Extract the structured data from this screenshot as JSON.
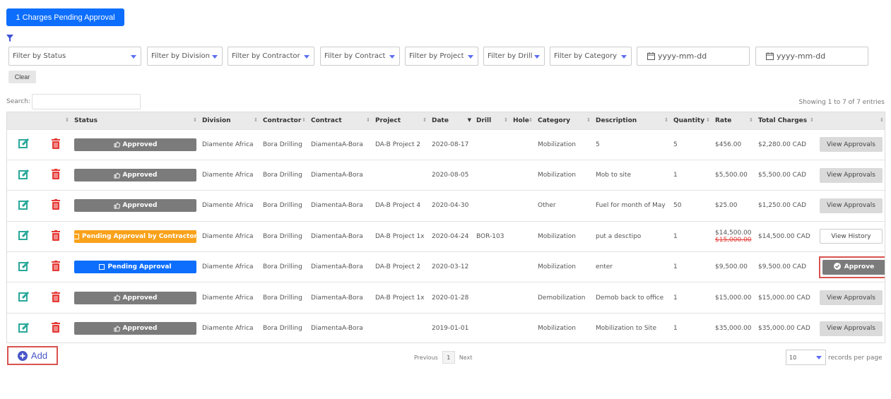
{
  "header": {
    "pending_label": "1 Charges Pending Approval"
  },
  "filters": [
    {
      "label": "Filter by Status"
    },
    {
      "label": "Filter by Division"
    },
    {
      "label": "Filter by Contractor"
    },
    {
      "label": "Filter by Contract"
    },
    {
      "label": "Filter by Project"
    },
    {
      "label": "Filter by Drill"
    },
    {
      "label": "Filter by Category"
    }
  ],
  "dates": [
    {
      "placeholder": "yyyy-mm-dd"
    },
    {
      "placeholder": "yyyy-mm-dd"
    }
  ],
  "clear_label": "Clear",
  "search": {
    "label": "Search:",
    "value": ""
  },
  "showing": "Showing 1 to 7 of 7 entries",
  "columns": [
    "Status",
    "Division",
    "Contractor",
    "Contract",
    "Project",
    "Date",
    "Drill",
    "Hole",
    "Category",
    "Description",
    "Quantity",
    "Rate",
    "Total Charges"
  ],
  "rows": [
    {
      "status": "Approved",
      "status_type": "approved",
      "division": "Diamente Africa",
      "contractor": "Bora Drilling",
      "contract": "DiamentaA-Bora",
      "project": "DA-B Project 2",
      "date": "2020-08-17",
      "drill": "",
      "hole": "",
      "category": "Mobilization",
      "description": "5",
      "quantity": "5",
      "rate": "$456.00",
      "rate_old": "",
      "total": "$2,280.00 CAD",
      "action": "View Approvals",
      "action_type": "view"
    },
    {
      "status": "Approved",
      "status_type": "approved",
      "division": "Diamente Africa",
      "contractor": "Bora Drilling",
      "contract": "DiamentaA-Bora",
      "project": "",
      "date": "2020-08-05",
      "drill": "",
      "hole": "",
      "category": "Mobilization",
      "description": "Mob to site",
      "quantity": "1",
      "rate": "$5,500.00",
      "rate_old": "",
      "total": "$5,500.00 CAD",
      "action": "View Approvals",
      "action_type": "view"
    },
    {
      "status": "Approved",
      "status_type": "approved",
      "division": "Diamente Africa",
      "contractor": "Bora Drilling",
      "contract": "DiamentaA-Bora",
      "project": "DA-B Project 4",
      "date": "2020-04-30",
      "drill": "",
      "hole": "",
      "category": "Other",
      "description": "Fuel for month of May",
      "quantity": "50",
      "rate": "$25.00",
      "rate_old": "",
      "total": "$1,250.00 CAD",
      "action": "View Approvals",
      "action_type": "view"
    },
    {
      "status": "Pending Approval by Contractor",
      "status_type": "contractor",
      "division": "Diamente Africa",
      "contractor": "Bora Drilling",
      "contract": "DiamentaA-Bora",
      "project": "DA-B Project 1x",
      "date": "2020-04-24",
      "drill": "BOR-103",
      "hole": "",
      "category": "Mobilization",
      "description": "put a desctipo",
      "quantity": "1",
      "rate": "$14,500.00",
      "rate_old": "$15,000.00",
      "total": "$14,500.00 CAD",
      "action": "View History",
      "action_type": "history"
    },
    {
      "status": "Pending Approval",
      "status_type": "pending",
      "division": "Diamente Africa",
      "contractor": "Bora Drilling",
      "contract": "DiamentaA-Bora",
      "project": "DA-B Project 2",
      "date": "2020-03-12",
      "drill": "",
      "hole": "",
      "category": "Mobilization",
      "description": "enter",
      "quantity": "1",
      "rate": "$9,500.00",
      "rate_old": "",
      "total": "$9,500.00 CAD",
      "action": "Approve",
      "action_type": "approve"
    },
    {
      "status": "Approved",
      "status_type": "approved",
      "division": "Diamente Africa",
      "contractor": "Bora Drilling",
      "contract": "DiamentaA-Bora",
      "project": "DA-B Project 1x",
      "date": "2020-01-28",
      "drill": "",
      "hole": "",
      "category": "Demobilization",
      "description": "Demob back to office",
      "quantity": "1",
      "rate": "$15,000.00",
      "rate_old": "",
      "total": "$15,000.00 CAD",
      "action": "View Approvals",
      "action_type": "view"
    },
    {
      "status": "Approved",
      "status_type": "approved",
      "division": "Diamente Africa",
      "contractor": "Bora Drilling",
      "contract": "DiamentaA-Bora",
      "project": "",
      "date": "2019-01-01",
      "drill": "",
      "hole": "",
      "category": "Mobilization",
      "description": "Mobilization to Site",
      "quantity": "1",
      "rate": "$35,000.00",
      "rate_old": "",
      "total": "$35,000.00 CAD",
      "action": "View Approvals",
      "action_type": "view"
    }
  ],
  "add_label": "Add",
  "pagination": {
    "previous": "Previous",
    "page": "1",
    "next": "Next"
  },
  "records": {
    "value": "10",
    "label": "records per page"
  },
  "colors": {
    "primary": "#0d6efd",
    "approved": "#7b7b7b",
    "contractor_pending": "#f9a21b",
    "edit": "#2aa89a",
    "delete": "#e53935",
    "highlight": "#d9534f",
    "accent": "#5b6ef2"
  },
  "icons": {
    "filter": "filter-icon",
    "edit": "edit-icon",
    "delete": "trash-icon",
    "calendar": "calendar-icon",
    "thumbs_up": "thumbs-up-icon",
    "square": "square-icon",
    "check_circle": "check-circle-icon",
    "add": "plus-circle-icon"
  }
}
